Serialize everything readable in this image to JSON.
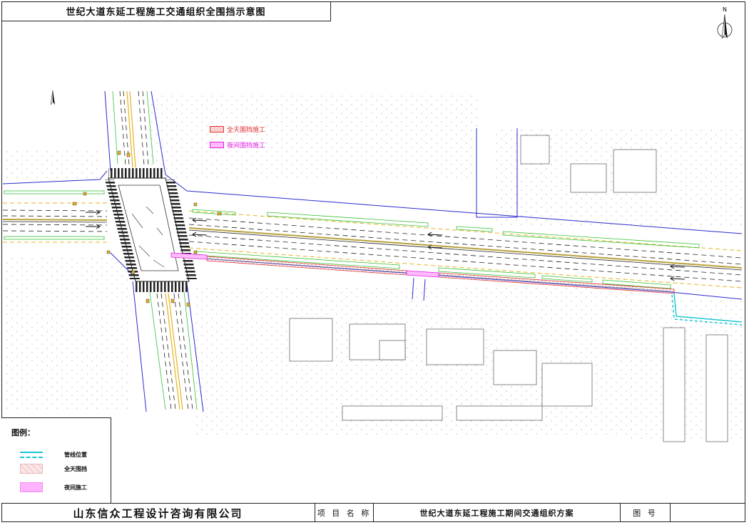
{
  "header": {
    "title": "世纪大道东延工程施工交通组织全围挡示意图"
  },
  "map_legend": {
    "all_day": "全天围挡施工",
    "night": "夜间围挡施工"
  },
  "north": {
    "label": "N"
  },
  "legend": {
    "title": "图例：",
    "items": [
      {
        "label": "管线位置",
        "icon": "pipeline-line-icon",
        "color": "#19c5d6"
      },
      {
        "label": "全天围挡",
        "icon": "hatched-enclosure-icon",
        "color": "#f6d6d6"
      },
      {
        "label": "夜间施工",
        "icon": "night-work-icon",
        "color": "#ffb3ff"
      }
    ]
  },
  "title_block": {
    "company": "山东信众工程设计咨询有限公司",
    "project_label": "项 目 名 称",
    "project_name": "世纪大道东延工程施工期间交通组织方案",
    "figure_label": "图 号",
    "figure_no": ""
  },
  "colors": {
    "boundary": "#2a2ad0",
    "median": "#b8a23a",
    "green_belt": "#35c035",
    "yellow_line": "#e5b321",
    "enclosure_all_day": "#f7d0d0",
    "enclosure_night": "#ffbbff",
    "pipeline": "#19c5d6"
  }
}
